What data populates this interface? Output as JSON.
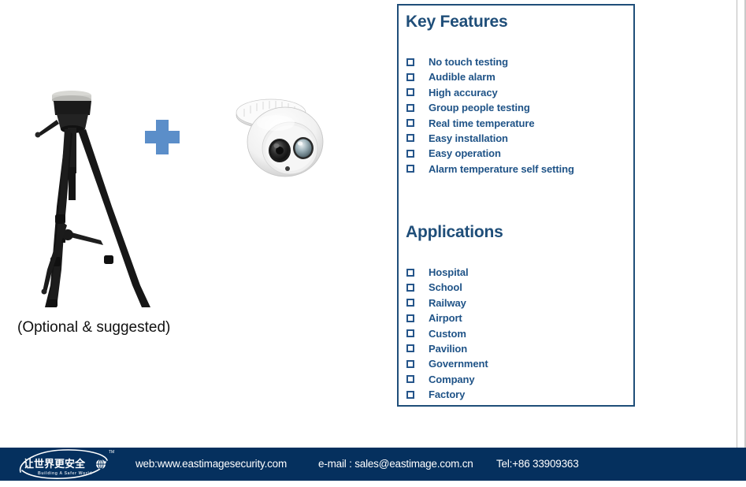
{
  "product": {
    "tripod_caption": "(Optional & suggested)",
    "plus_symbol": "plus-sign",
    "tripod_alt": "camera-tripod",
    "camera_alt": "dome-camera"
  },
  "panel": {
    "key_features": {
      "heading": "Key Features",
      "items": [
        "No touch testing",
        "Audible alarm",
        "High accuracy",
        "Group people testing",
        "Real time temperature",
        "Easy installation",
        "Easy operation",
        "Alarm temperature self setting"
      ]
    },
    "applications": {
      "heading": "Applications",
      "items": [
        "Hospital",
        "School",
        "Railway",
        "Airport",
        "Custom",
        "Pavilion",
        "Government",
        "Company",
        "Factory"
      ]
    }
  },
  "footer": {
    "logo_chinese": "让世界更安全",
    "logo_tagline": "Building A Safer World",
    "logo_trademark": "TM",
    "website": "web:www.eastimagesecurity.com",
    "email": "e-mail : sales@eastimage.com.cn",
    "telephone": "Tel:+86 33909363"
  },
  "colors": {
    "panel_border": "#1f4e79",
    "heading": "#1f4e79",
    "list_text": "#1f5387",
    "checkbox": "#25558a",
    "plus": "#5b8ec9",
    "footer_bg": "#05305e",
    "caption": "#111111"
  }
}
